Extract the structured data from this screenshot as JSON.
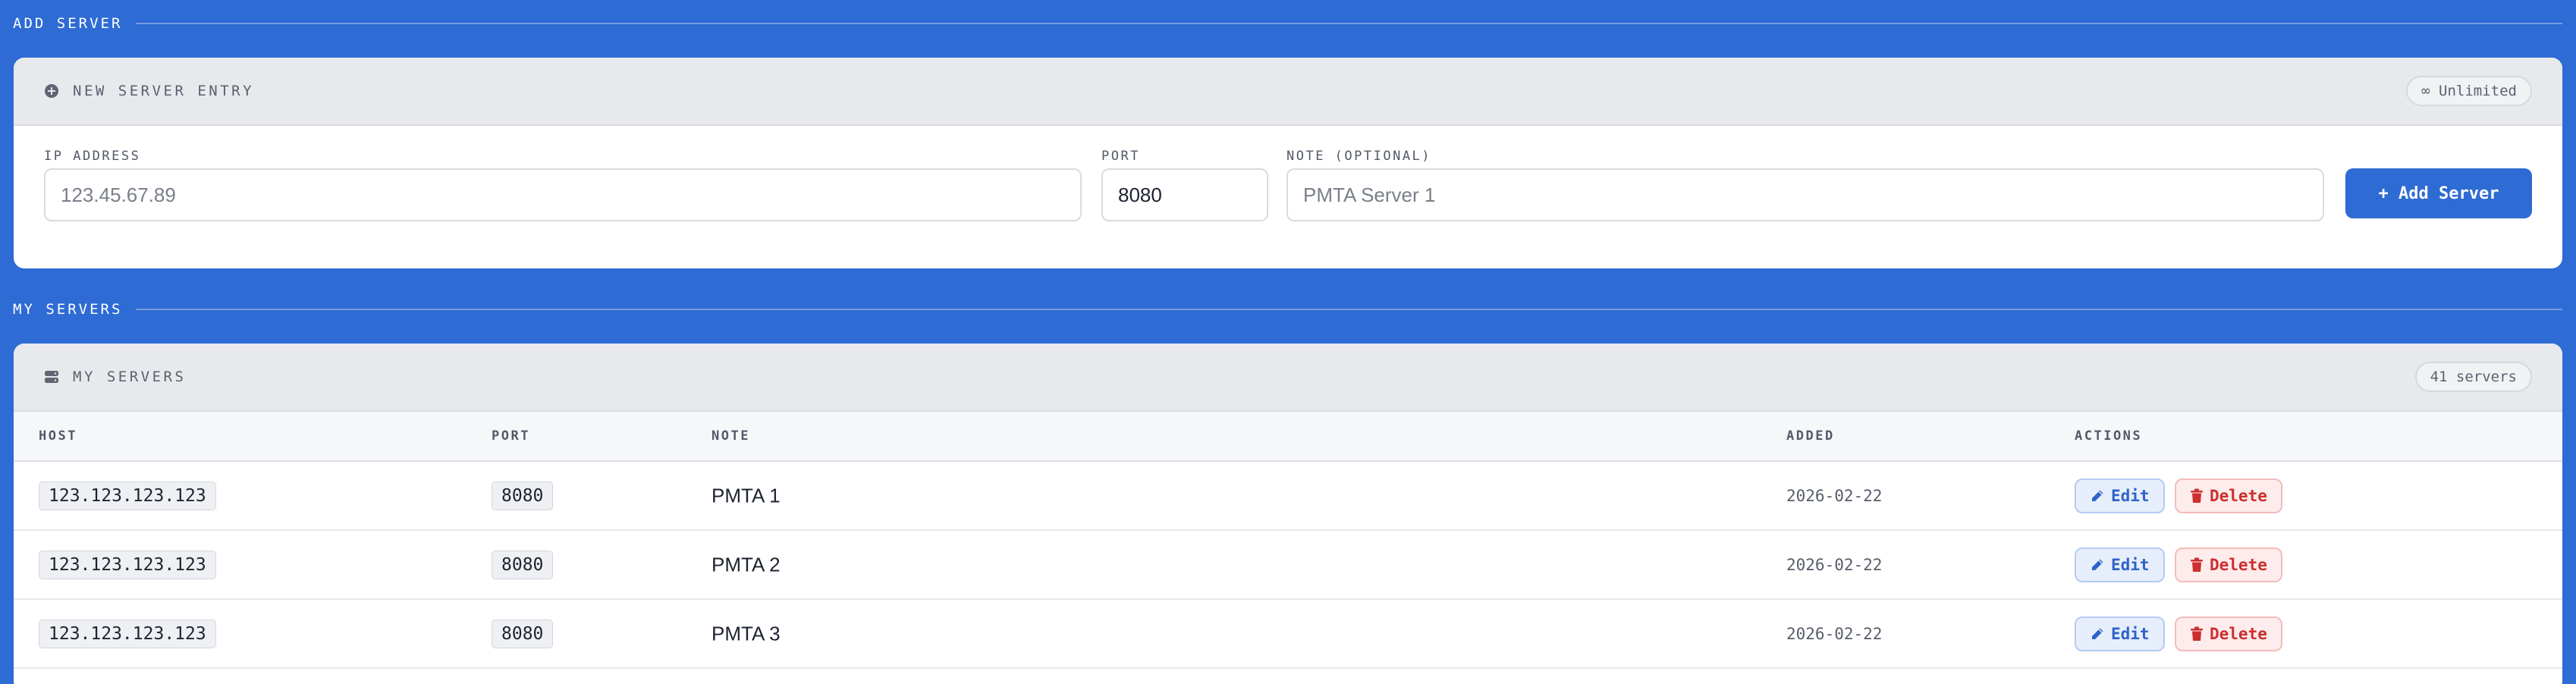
{
  "add_section": {
    "title": "ADD SERVER"
  },
  "entry_card": {
    "title": "NEW SERVER ENTRY",
    "limit_badge": "∞ Unlimited",
    "fields": {
      "ip": {
        "label": "IP ADDRESS",
        "placeholder": "123.45.67.89",
        "value": ""
      },
      "port": {
        "label": "PORT",
        "value": "8080"
      },
      "note": {
        "label": "NOTE (OPTIONAL)",
        "placeholder": "PMTA Server 1",
        "value": ""
      }
    },
    "add_button": "+ Add Server"
  },
  "servers_section": {
    "title": "MY SERVERS"
  },
  "servers_card": {
    "title": "MY SERVERS",
    "count_badge": "41 servers",
    "columns": {
      "host": "HOST",
      "port": "PORT",
      "note": "NOTE",
      "added": "ADDED",
      "actions": "ACTIONS"
    },
    "rows": [
      {
        "host": "123.123.123.123",
        "port": "8080",
        "note": "PMTA 1",
        "added": "2026-02-22",
        "edit": "Edit",
        "delete": "Delete"
      },
      {
        "host": "123.123.123.123",
        "port": "8080",
        "note": "PMTA 2",
        "added": "2026-02-22",
        "edit": "Edit",
        "delete": "Delete"
      },
      {
        "host": "123.123.123.123",
        "port": "8080",
        "note": "PMTA 3",
        "added": "2026-02-22",
        "edit": "Edit",
        "delete": "Delete"
      }
    ]
  },
  "colors": {
    "background": "#2e6bd4",
    "primary_button": "#2e6bd4",
    "edit_text": "#2e63c9",
    "delete_text": "#cc2f2f"
  },
  "icons": {
    "entry_card": "plus-circle-icon",
    "servers_card": "server-stack-icon",
    "edit": "pencil-icon",
    "delete": "trash-icon"
  }
}
